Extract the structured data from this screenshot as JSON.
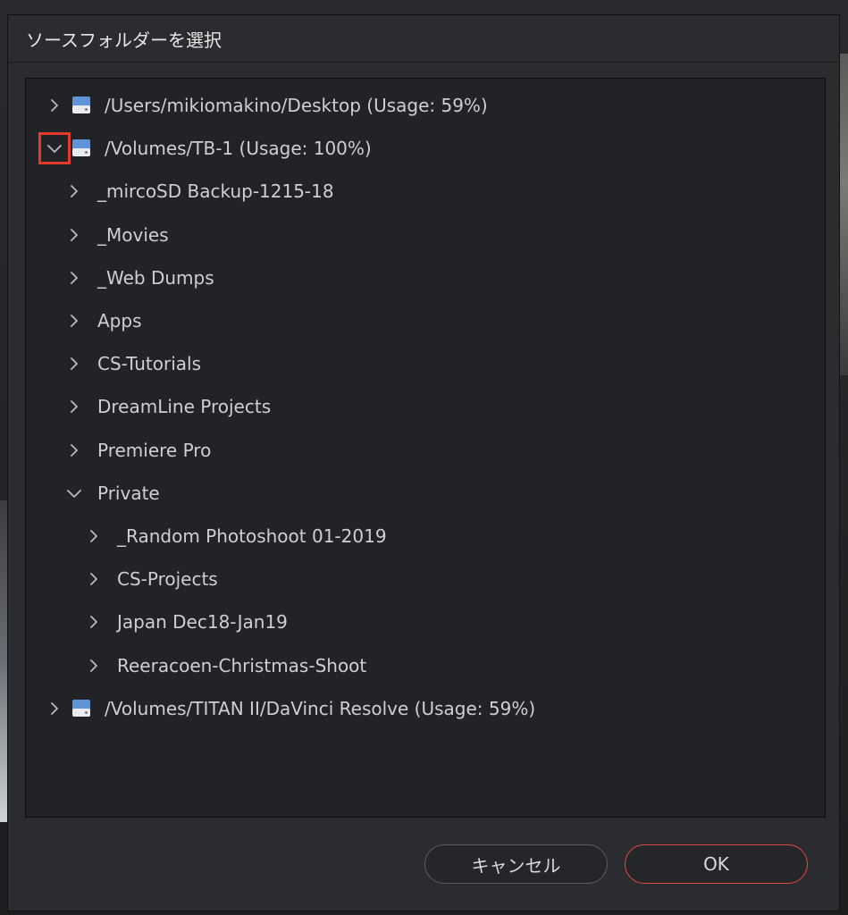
{
  "dialog": {
    "title": "ソースフォルダーを選択"
  },
  "tree": [
    {
      "label": "/Users/mikiomakino/Desktop (Usage: 59%)",
      "level": 0,
      "type": "drive",
      "expanded": false
    },
    {
      "label": "/Volumes/TB-1 (Usage: 100%)",
      "level": 0,
      "type": "drive",
      "expanded": true
    },
    {
      "label": "_mircoSD Backup-1215-18",
      "level": 1,
      "type": "folder",
      "expanded": false
    },
    {
      "label": "_Movies",
      "level": 1,
      "type": "folder",
      "expanded": false
    },
    {
      "label": "_Web Dumps",
      "level": 1,
      "type": "folder",
      "expanded": false
    },
    {
      "label": "Apps",
      "level": 1,
      "type": "folder",
      "expanded": false
    },
    {
      "label": "CS-Tutorials",
      "level": 1,
      "type": "folder",
      "expanded": false
    },
    {
      "label": "DreamLine Projects",
      "level": 1,
      "type": "folder",
      "expanded": false
    },
    {
      "label": "Premiere Pro",
      "level": 1,
      "type": "folder",
      "expanded": false
    },
    {
      "label": "Private",
      "level": 1,
      "type": "folder",
      "expanded": true
    },
    {
      "label": "_Random Photoshoot 01-2019",
      "level": 2,
      "type": "folder",
      "expanded": false
    },
    {
      "label": "CS-Projects",
      "level": 2,
      "type": "folder",
      "expanded": false
    },
    {
      "label": "Japan Dec18-Jan19",
      "level": 2,
      "type": "folder",
      "expanded": false
    },
    {
      "label": "Reeracoen-Christmas-Shoot",
      "level": 2,
      "type": "folder",
      "expanded": false
    },
    {
      "label": "/Volumes/TITAN II/DaVinci Resolve (Usage: 59%)",
      "level": 0,
      "type": "drive",
      "expanded": false
    }
  ],
  "buttons": {
    "cancel": "キャンセル",
    "ok": "OK"
  },
  "colors": {
    "highlight": "#e23b2c",
    "ok_border": "#e04a3a"
  }
}
